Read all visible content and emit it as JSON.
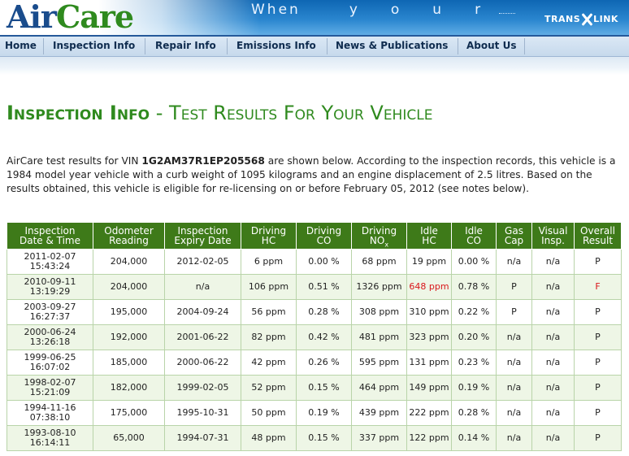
{
  "header": {
    "logo_part1": "Air",
    "logo_part2": "Care",
    "tagline_words": [
      "When",
      "y",
      "o",
      "u",
      "r"
    ],
    "partner_part1": "TRANS",
    "partner_part2": "LINK"
  },
  "nav": {
    "items": [
      "Home",
      "Inspection Info",
      "Repair Info",
      "Emissions Info",
      "News & Publications",
      "About Us"
    ]
  },
  "page": {
    "title_bold": "Inspection Info",
    "title_rest": " - Test Results For Your Vehicle",
    "intro_before_vin": "AirCare test results for VIN ",
    "vin": "1G2AM37R1EP205568",
    "intro_after_vin": " are shown below. According to the inspection records, this vehicle is a 1984 model year vehicle with a curb weight of 1095 kilograms and an engine displacement of 2.5 litres. Based on the results obtained, this vehicle is eligible for re-licensing on or before February 05, 2012 (see notes below)."
  },
  "table": {
    "headers": [
      {
        "line1": "Inspection",
        "line2": "Date & Time"
      },
      {
        "line1": "Odometer",
        "line2": "Reading"
      },
      {
        "line1": "Inspection",
        "line2": "Expiry Date"
      },
      {
        "line1": "Driving",
        "line2": "HC"
      },
      {
        "line1": "Driving",
        "line2": "CO"
      },
      {
        "line1": "Driving",
        "line2": "NO",
        "sub": "x"
      },
      {
        "line1": "Idle",
        "line2": "HC"
      },
      {
        "line1": "Idle",
        "line2": "CO"
      },
      {
        "line1": "Gas",
        "line2": "Cap"
      },
      {
        "line1": "Visual",
        "line2": "Insp."
      },
      {
        "line1": "Overall",
        "line2": "Result"
      }
    ],
    "rows": [
      {
        "date": "2011-02-07",
        "time": "15:43:24",
        "odometer": "204,000",
        "expiry": "2012-02-05",
        "drv_hc": "6 ppm",
        "drv_co": "0.00 %",
        "drv_nox": "68 ppm",
        "idle_hc": "19 ppm",
        "idle_co": "0.00 %",
        "gas_cap": "n/a",
        "visual": "n/a",
        "overall": "P",
        "idle_hc_fail": false,
        "overall_fail": false
      },
      {
        "date": "2010-09-11",
        "time": "13:19:29",
        "odometer": "204,000",
        "expiry": "n/a",
        "drv_hc": "106 ppm",
        "drv_co": "0.51 %",
        "drv_nox": "1326 ppm",
        "idle_hc": "648 ppm",
        "idle_co": "0.78 %",
        "gas_cap": "P",
        "visual": "n/a",
        "overall": "F",
        "idle_hc_fail": true,
        "overall_fail": true
      },
      {
        "date": "2003-09-27",
        "time": "16:27:37",
        "odometer": "195,000",
        "expiry": "2004-09-24",
        "drv_hc": "56 ppm",
        "drv_co": "0.28 %",
        "drv_nox": "308 ppm",
        "idle_hc": "310 ppm",
        "idle_co": "0.22 %",
        "gas_cap": "P",
        "visual": "n/a",
        "overall": "P",
        "idle_hc_fail": false,
        "overall_fail": false
      },
      {
        "date": "2000-06-24",
        "time": "13:26:18",
        "odometer": "192,000",
        "expiry": "2001-06-22",
        "drv_hc": "82 ppm",
        "drv_co": "0.42 %",
        "drv_nox": "481 ppm",
        "idle_hc": "323 ppm",
        "idle_co": "0.20 %",
        "gas_cap": "n/a",
        "visual": "n/a",
        "overall": "P",
        "idle_hc_fail": false,
        "overall_fail": false
      },
      {
        "date": "1999-06-25",
        "time": "16:07:02",
        "odometer": "185,000",
        "expiry": "2000-06-22",
        "drv_hc": "42 ppm",
        "drv_co": "0.26 %",
        "drv_nox": "595 ppm",
        "idle_hc": "131 ppm",
        "idle_co": "0.23 %",
        "gas_cap": "n/a",
        "visual": "n/a",
        "overall": "P",
        "idle_hc_fail": false,
        "overall_fail": false
      },
      {
        "date": "1998-02-07",
        "time": "15:21:09",
        "odometer": "182,000",
        "expiry": "1999-02-05",
        "drv_hc": "52 ppm",
        "drv_co": "0.15 %",
        "drv_nox": "464 ppm",
        "idle_hc": "149 ppm",
        "idle_co": "0.19 %",
        "gas_cap": "n/a",
        "visual": "n/a",
        "overall": "P",
        "idle_hc_fail": false,
        "overall_fail": false
      },
      {
        "date": "1994-11-16",
        "time": "07:38:10",
        "odometer": "175,000",
        "expiry": "1995-10-31",
        "drv_hc": "50 ppm",
        "drv_co": "0.19 %",
        "drv_nox": "439 ppm",
        "idle_hc": "222 ppm",
        "idle_co": "0.28 %",
        "gas_cap": "n/a",
        "visual": "n/a",
        "overall": "P",
        "idle_hc_fail": false,
        "overall_fail": false
      },
      {
        "date": "1993-08-10",
        "time": "16:14:11",
        "odometer": "65,000",
        "expiry": "1994-07-31",
        "drv_hc": "48 ppm",
        "drv_co": "0.15 %",
        "drv_nox": "337 ppm",
        "idle_hc": "122 ppm",
        "idle_co": "0.14 %",
        "gas_cap": "n/a",
        "visual": "n/a",
        "overall": "P",
        "idle_hc_fail": false,
        "overall_fail": false
      }
    ]
  },
  "colors": {
    "title_green": "#2f8a1e",
    "header_green": "#3e7a19",
    "fail_red": "#d9161a",
    "nav_text": "#0f2c4f"
  }
}
